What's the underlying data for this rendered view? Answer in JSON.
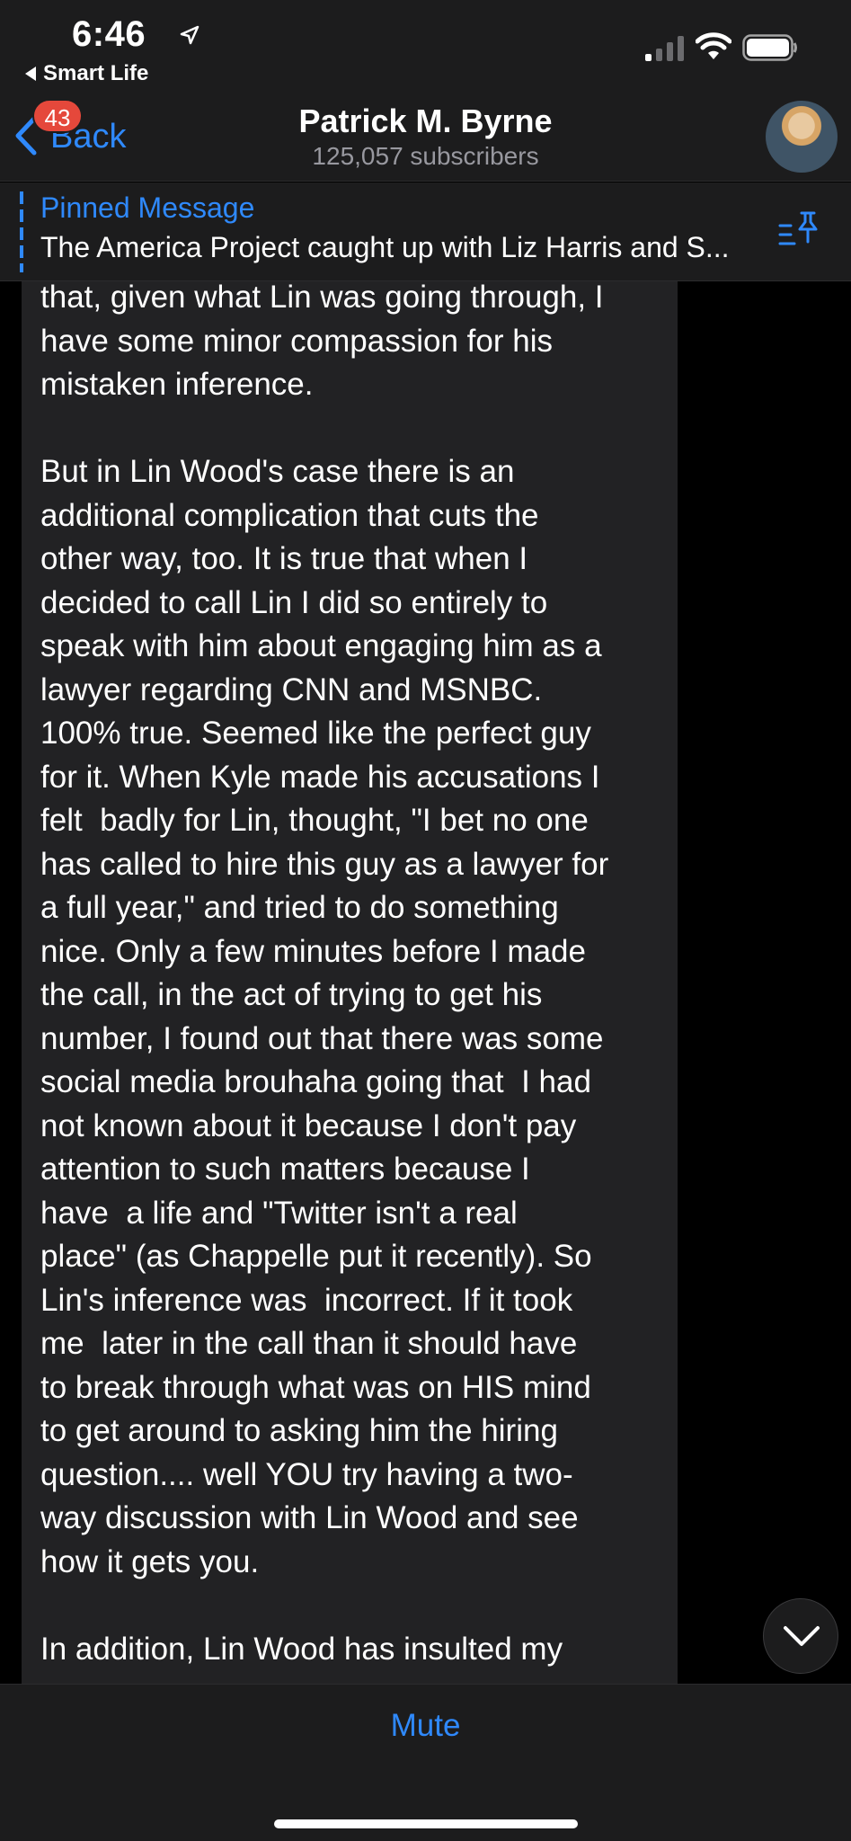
{
  "status_bar": {
    "time": "6:46",
    "back_app": "Smart Life"
  },
  "header": {
    "back_label": "Back",
    "badge_count": "43",
    "channel_name": "Patrick M. Byrne",
    "subscribers": "125,057 subscribers"
  },
  "pinned": {
    "title": "Pinned Message",
    "text": "The America Project caught up with Liz Harris and S..."
  },
  "message": {
    "lines": [
      "that, given what Lin was going through, I",
      "have some minor compassion for his",
      "mistaken inference.",
      "",
      "But in Lin Wood's case there is an",
      "additional complication that cuts the",
      "other way, too. It is true that when I",
      "decided to call Lin I did so entirely to",
      "speak with him about engaging him as a",
      "lawyer regarding CNN and MSNBC.",
      "100% true. Seemed like the perfect guy",
      "for it. When Kyle made his accusations I",
      "felt  badly for Lin, thought, \"I bet no one",
      "has called to hire this guy as a lawyer for",
      "a full year,\" and tried to do something",
      "nice. Only a few minutes before I made",
      "the call, in the act of trying to get his",
      "number, I found out that there was some",
      "social media brouhaha going that  I had",
      "not known about it because I don't pay",
      "attention to such matters because I",
      "have  a life and \"Twitter isn't a real",
      "place\" (as Chappelle put it recently). So",
      "Lin's inference was  incorrect. If it took",
      "me  later in the call than it should have",
      "to break through what was on HIS mind",
      "to get around to asking him the hiring",
      "question.... well YOU try having a two-",
      "way discussion with Lin Wood and see",
      "how it gets you.",
      "",
      "In addition, Lin Wood has insulted my"
    ]
  },
  "bottom": {
    "mute_label": "Mute"
  },
  "colors": {
    "accent": "#2f89fc",
    "badge": "#e5483b",
    "bar_background": "#1c1c1d",
    "bubble_background": "#222224"
  },
  "icons": {
    "location": "location-arrow-icon",
    "signal": "cellular-signal-icon",
    "wifi": "wifi-icon",
    "battery": "battery-icon",
    "back": "chevron-left-icon",
    "pin": "pin-list-icon",
    "scroll": "chevron-down-icon"
  }
}
